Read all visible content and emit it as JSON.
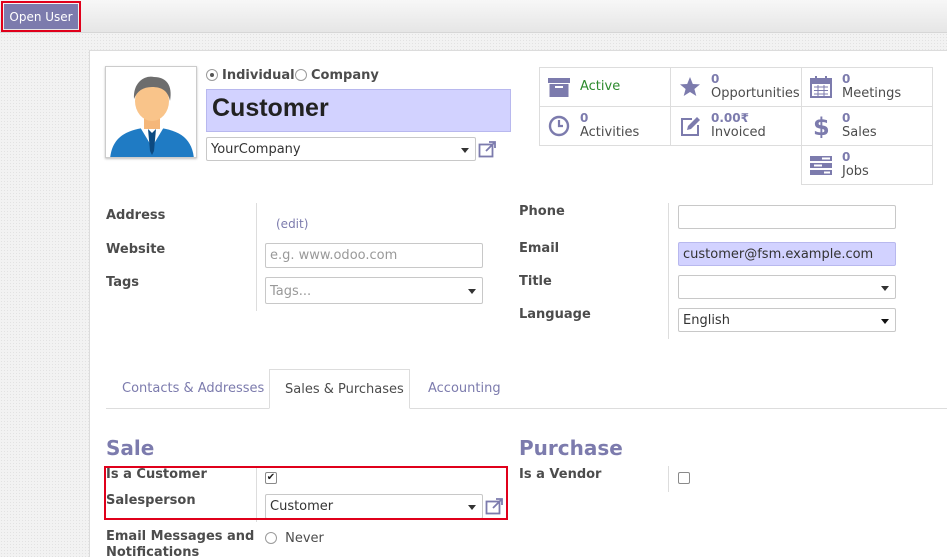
{
  "toolbar": {
    "open_user_label": "Open User"
  },
  "partner": {
    "type_options": [
      "Individual",
      "Company"
    ],
    "type_selected": "Individual",
    "name": "Customer",
    "company": "YourCompany"
  },
  "smart_buttons": {
    "active": {
      "label": "Active",
      "icon": "archive-icon",
      "color": "#2d8a2d"
    },
    "opportunities": {
      "count": "0",
      "label": "Opportunities",
      "icon": "star-icon"
    },
    "meetings": {
      "count": "0",
      "label": "Meetings",
      "icon": "calendar-icon"
    },
    "activities": {
      "count": "0",
      "label": "Activities",
      "icon": "clock-icon"
    },
    "invoiced": {
      "count": "0.00₹",
      "label": "Invoiced",
      "icon": "pencil-square-icon"
    },
    "sales": {
      "count": "0",
      "label": "Sales",
      "icon": "dollar-icon"
    },
    "jobs": {
      "count": "0",
      "label": "Jobs",
      "icon": "tasks-icon"
    }
  },
  "left_fields": {
    "address_label": "Address",
    "address_edit": "(edit)",
    "website_label": "Website",
    "website_placeholder": "e.g. www.odoo.com",
    "tags_label": "Tags",
    "tags_placeholder": "Tags..."
  },
  "right_fields": {
    "phone_label": "Phone",
    "phone_value": "",
    "email_label": "Email",
    "email_value": "customer@fsm.example.com",
    "title_label": "Title",
    "title_value": "",
    "language_label": "Language",
    "language_value": "English"
  },
  "tabs": [
    {
      "label": "Contacts & Addresses",
      "active": false
    },
    {
      "label": "Sales & Purchases",
      "active": true
    },
    {
      "label": "Accounting",
      "active": false
    }
  ],
  "sale": {
    "title": "Sale",
    "is_customer_label": "Is a Customer",
    "is_customer": true,
    "salesperson_label": "Salesperson",
    "salesperson_value": "Customer",
    "email_messages_label_line1": "Email Messages and",
    "email_messages_label_line2": "Notifications",
    "email_messages_option": "Never"
  },
  "purchase": {
    "title": "Purchase",
    "is_vendor_label": "Is a Vendor",
    "is_vendor": false
  },
  "colors": {
    "accent": "#7c7bad",
    "highlight": "#e0001b",
    "field_required": "#d2d2ff"
  }
}
